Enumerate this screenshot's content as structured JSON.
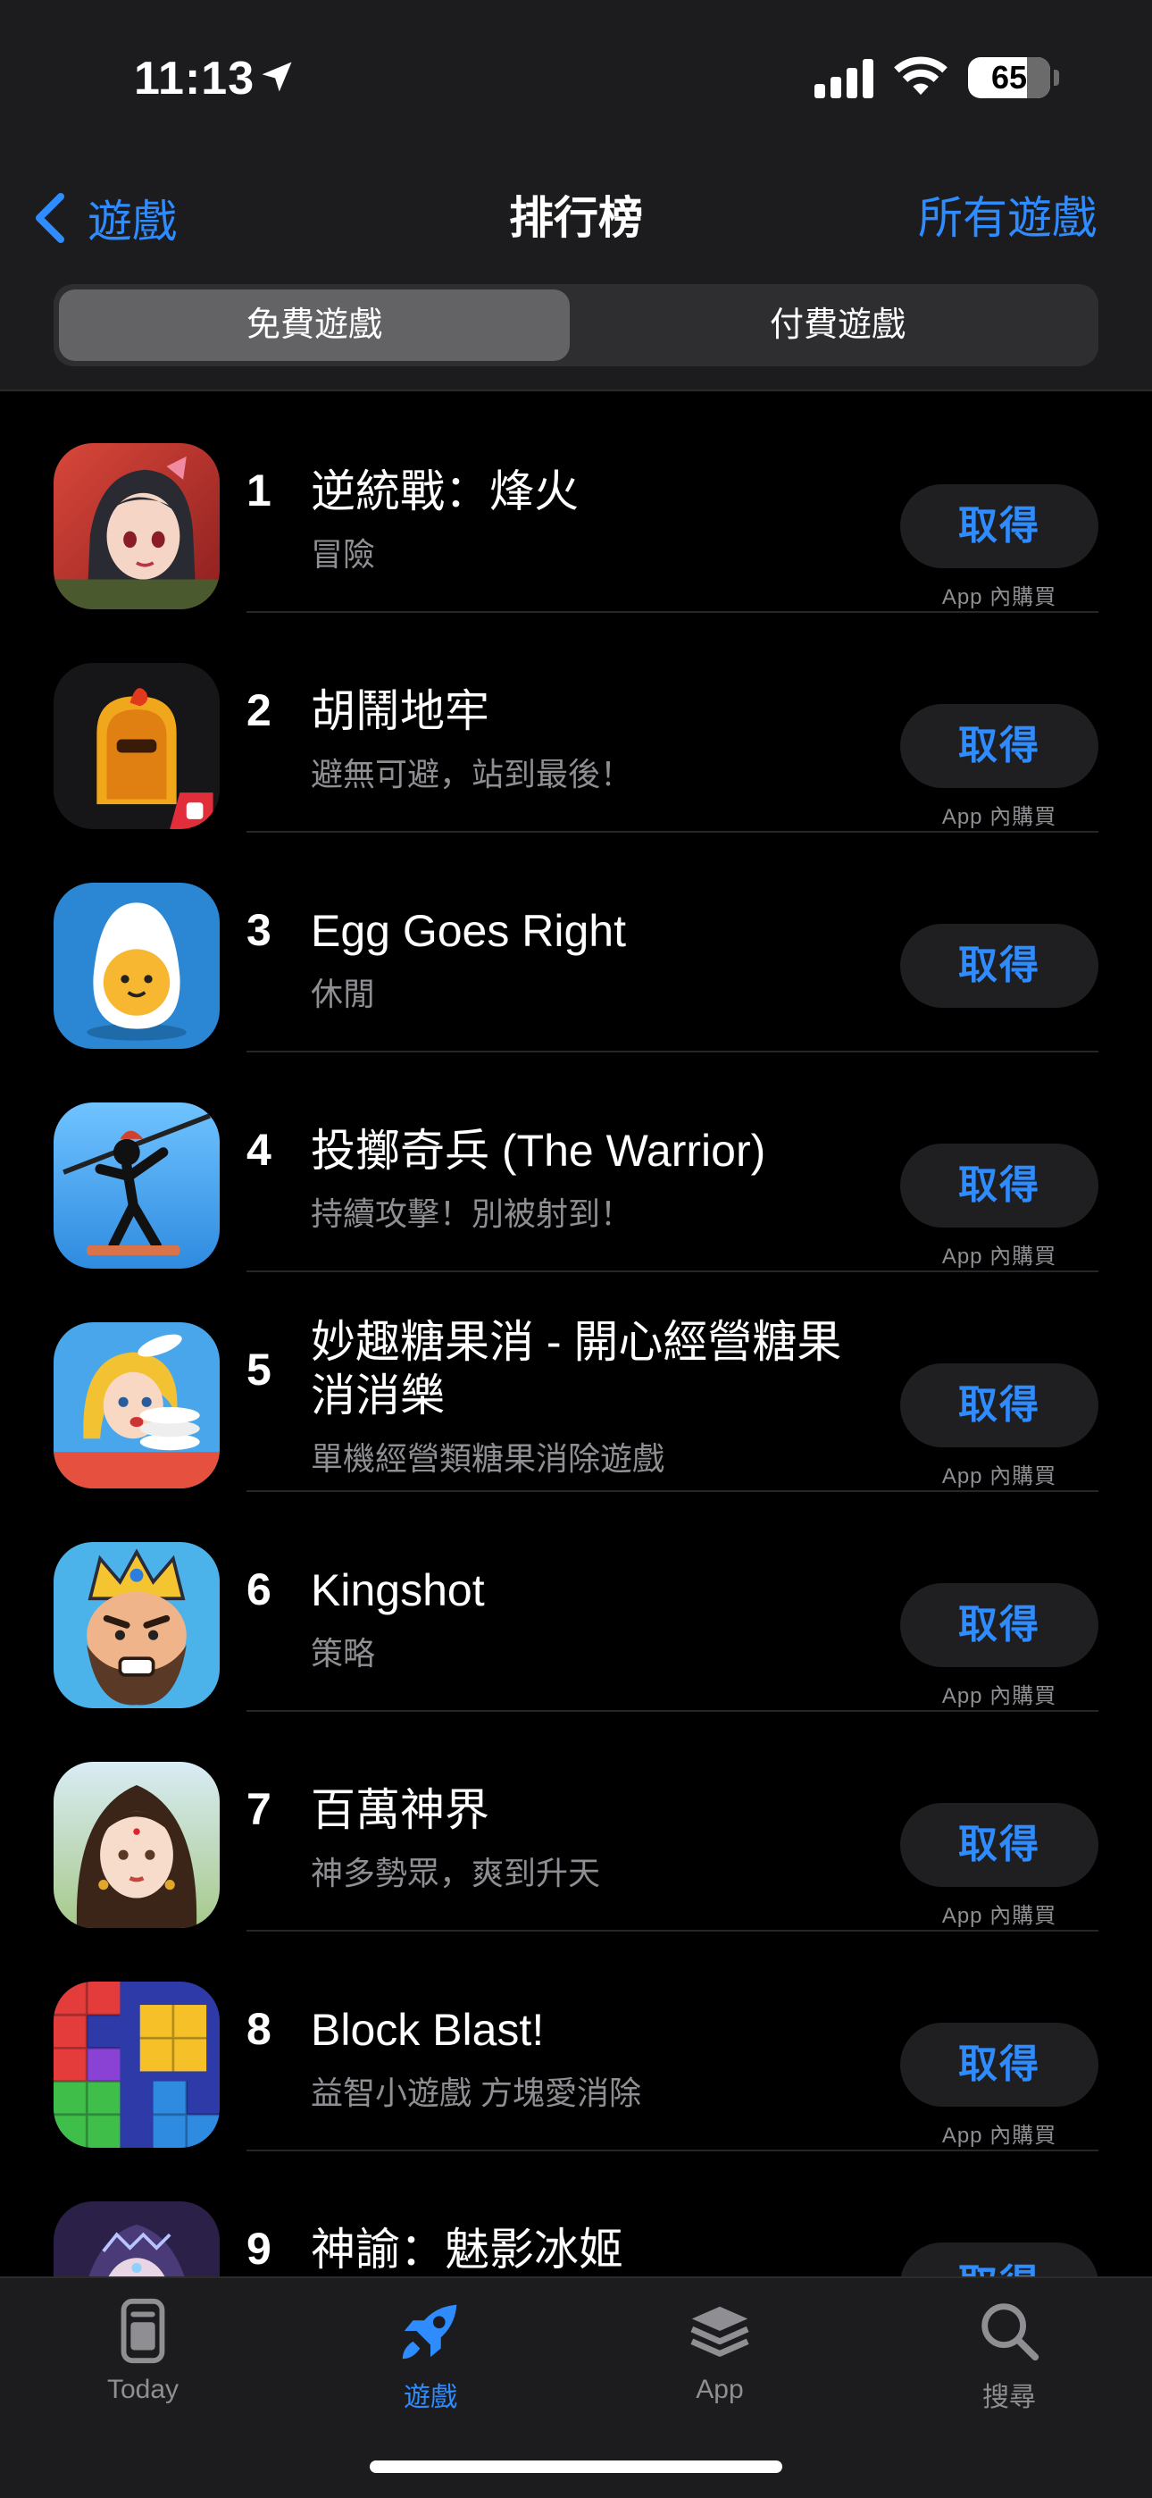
{
  "status": {
    "time": "11:13",
    "battery": "65"
  },
  "nav": {
    "back_label": "遊戲",
    "title": "排行榜",
    "all_games": "所有遊戲"
  },
  "segments": {
    "free": "免費遊戲",
    "paid": "付費遊戲"
  },
  "get_label": "取得",
  "iap_label": "App 內購買",
  "apps": [
    {
      "rank": "1",
      "name": "逆統戰：烽火",
      "subtitle": "冒險",
      "iap": true,
      "icon": "anime-girl-icon"
    },
    {
      "rank": "2",
      "name": "胡鬧地牢",
      "subtitle": "避無可避，站到最後！",
      "iap": true,
      "icon": "chicken-dungeon-icon"
    },
    {
      "rank": "3",
      "name": "Egg Goes Right",
      "subtitle": "休閒",
      "iap": false,
      "icon": "egg-icon"
    },
    {
      "rank": "4",
      "name": "投擲奇兵 (The Warrior)",
      "subtitle": "持續攻擊！別被射到！",
      "iap": true,
      "icon": "spear-warrior-icon"
    },
    {
      "rank": "5",
      "name": "妙趣糖果消 - 開心經營糖果消消樂",
      "subtitle": "單機經營類糖果消除遊戲",
      "iap": true,
      "icon": "dish-girl-icon"
    },
    {
      "rank": "6",
      "name": "Kingshot",
      "subtitle": "策略",
      "iap": true,
      "icon": "king-icon"
    },
    {
      "rank": "7",
      "name": "百萬神界",
      "subtitle": "神多勢眾，爽到升天",
      "iap": true,
      "icon": "goddess-icon"
    },
    {
      "rank": "8",
      "name": "Block Blast!",
      "subtitle": "益智小遊戲 方塊愛消除",
      "iap": true,
      "icon": "blocks-icon"
    },
    {
      "rank": "9",
      "name": "神諭：魅影冰姬",
      "subtitle": "",
      "iap": false,
      "icon": "ice-princess-icon"
    }
  ],
  "tabs": {
    "today": "Today",
    "games": "遊戲",
    "apps": "App",
    "search": "搜尋"
  },
  "colors": {
    "accent": "#2f8cff",
    "background": "#000000",
    "bar": "#1c1c1e"
  }
}
